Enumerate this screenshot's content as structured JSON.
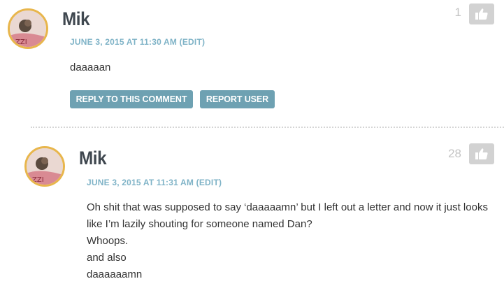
{
  "comments": [
    {
      "author": "Mik",
      "date": "JUNE 3, 2015 AT 11:30 AM",
      "edit_label": "(EDIT)",
      "body": [
        "daaaaan"
      ],
      "likes": "1",
      "reply_label": "REPLY TO THIS COMMENT",
      "report_label": "REPORT USER"
    },
    {
      "author": "Mik",
      "date": "JUNE 3, 2015 AT 11:31 AM",
      "edit_label": "(EDIT)",
      "body": [
        "Oh shit that was supposed to say ‘daaaaamn’ but I left out a letter and now it just looks",
        "like I’m lazily shouting for someone named Dan?",
        "Whoops.",
        "and also",
        "daaaaaamn"
      ],
      "likes": "28"
    }
  ],
  "colors": {
    "avatar_border": "#e8b64c",
    "meta": "#7fb3c7",
    "button": "#6ea1b2",
    "thumb_bg": "#d2d2d2"
  },
  "icons": [
    "thumbs-up-icon"
  ]
}
